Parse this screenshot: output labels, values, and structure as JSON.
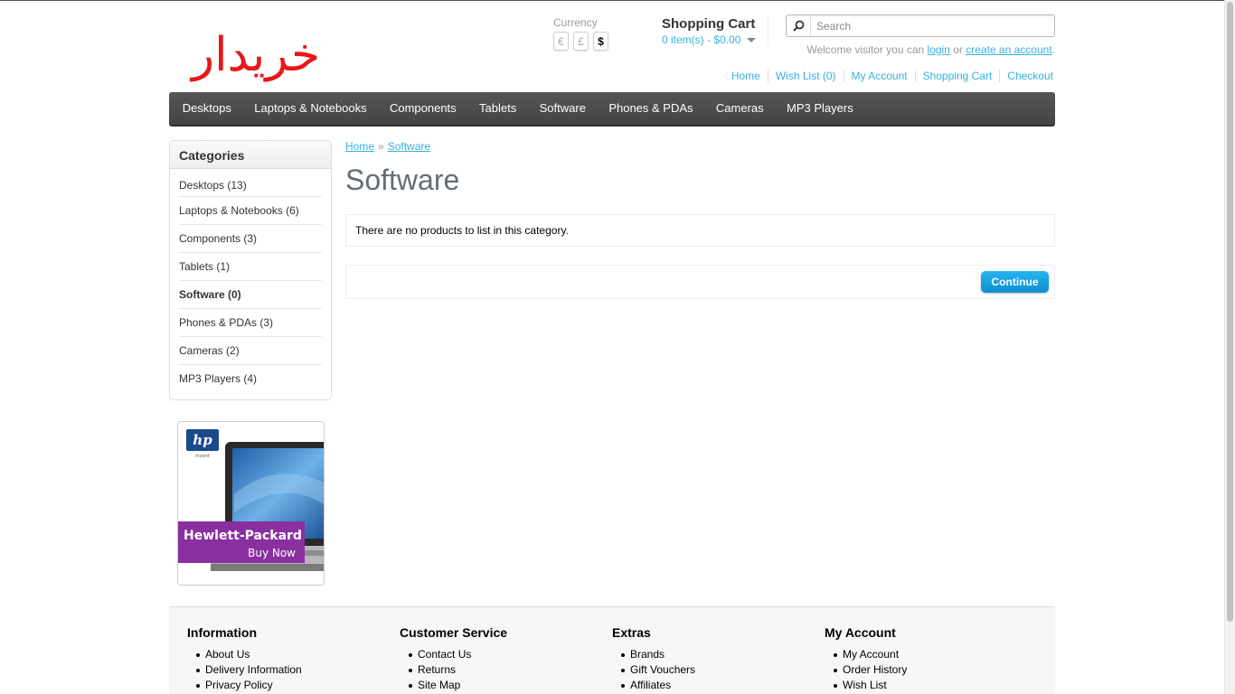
{
  "logo": {
    "text": "خریدار"
  },
  "currency": {
    "label": "Currency",
    "options": [
      "€",
      "£",
      "$"
    ],
    "selected": "$"
  },
  "cart": {
    "title": "Shopping Cart",
    "total": "0 item(s) - $0.00"
  },
  "search": {
    "placeholder": "Search"
  },
  "welcome": {
    "prefix": "Welcome visitor you can",
    "login": "login",
    "or": "or",
    "create": "create an account",
    "suffix": "."
  },
  "toplinks": [
    "Home",
    "Wish List (0)",
    "My Account",
    "Shopping Cart",
    "Checkout"
  ],
  "menu": [
    "Desktops",
    "Laptops & Notebooks",
    "Components",
    "Tablets",
    "Software",
    "Phones & PDAs",
    "Cameras",
    "MP3 Players"
  ],
  "sidebar": {
    "heading": "Categories",
    "items": [
      "Desktops (13)",
      "Laptops & Notebooks (6)",
      "Components (3)",
      "Tablets (1)",
      "Software (0)",
      "Phones & PDAs (3)",
      "Cameras (2)",
      "MP3 Players (4)"
    ],
    "active_index": 4
  },
  "banner": {
    "brand": "Hewlett-Packard",
    "cta": "Buy Now",
    "logo_text": "hp",
    "logo_sub": "invent"
  },
  "breadcrumb": {
    "home": "Home",
    "sep": "»",
    "current": "Software"
  },
  "page": {
    "title": "Software",
    "empty_message": "There are no products to list in this category.",
    "continue": "Continue"
  },
  "footer": {
    "columns": [
      {
        "title": "Information",
        "links": [
          "About Us",
          "Delivery Information",
          "Privacy Policy"
        ]
      },
      {
        "title": "Customer Service",
        "links": [
          "Contact Us",
          "Returns",
          "Site Map"
        ]
      },
      {
        "title": "Extras",
        "links": [
          "Brands",
          "Gift Vouchers",
          "Affiliates"
        ]
      },
      {
        "title": "My Account",
        "links": [
          "My Account",
          "Order History",
          "Wish List"
        ]
      }
    ]
  },
  "colors": {
    "accent": "#38b0e3",
    "menu_bg": "#4d4d4d",
    "logo": "#e81818",
    "button": "#1aa1df",
    "banner_purple": "#8a2fa0"
  }
}
